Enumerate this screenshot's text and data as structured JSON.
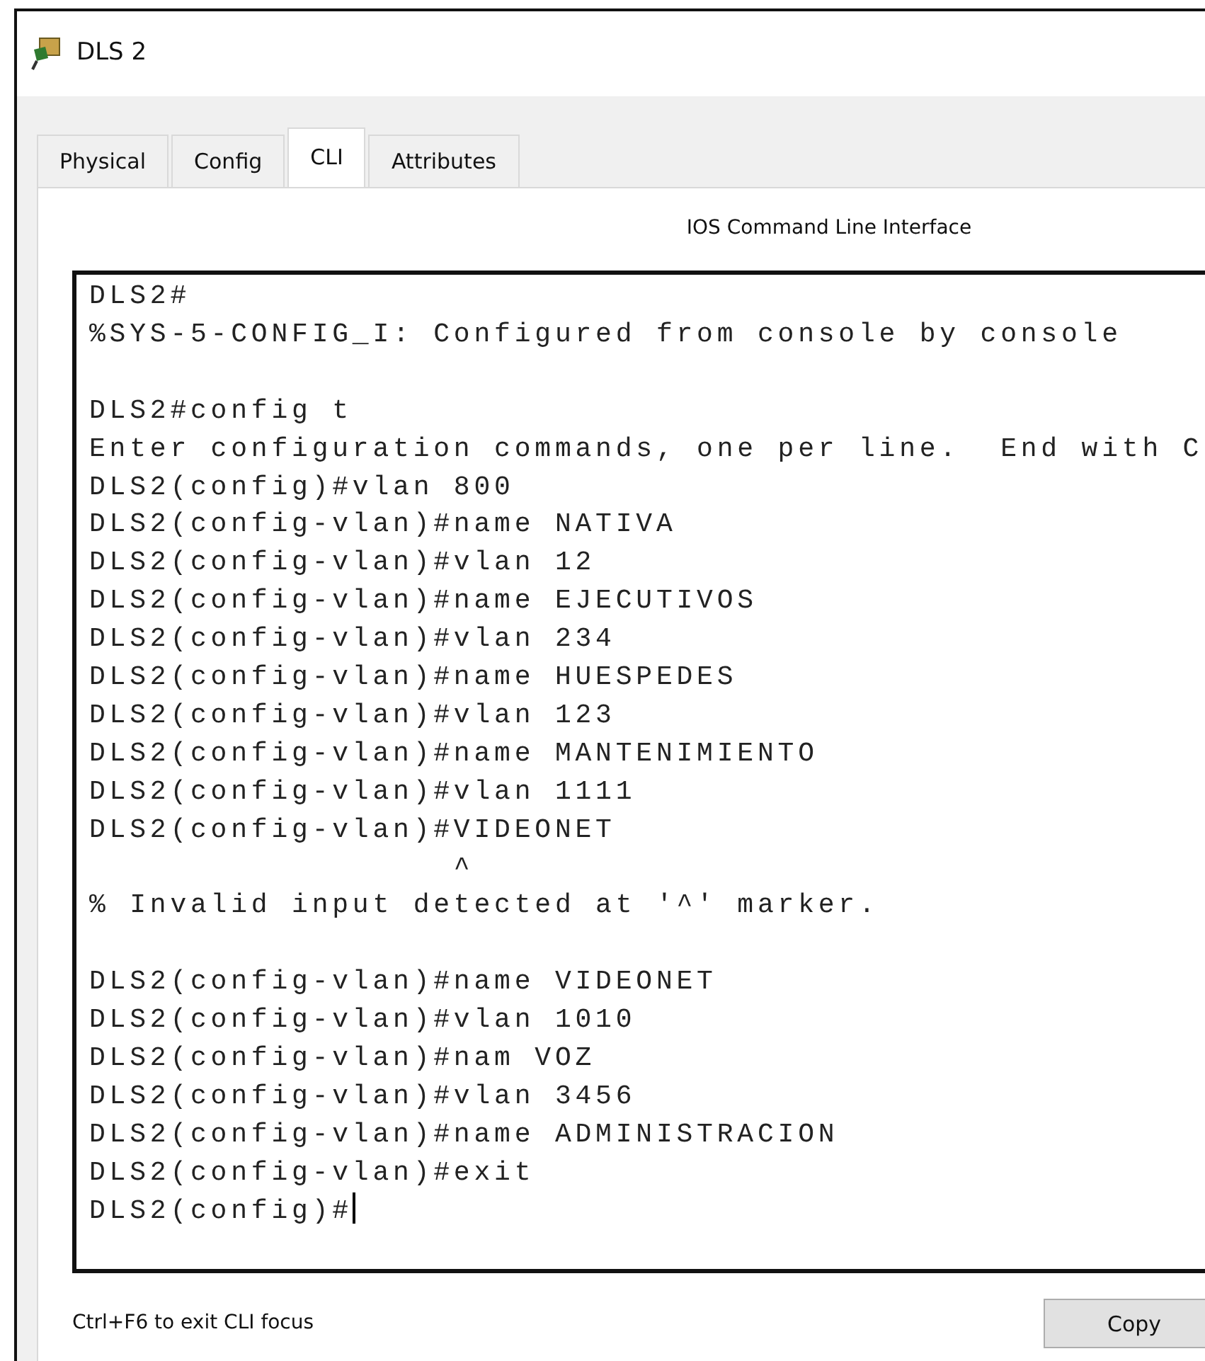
{
  "window": {
    "title": "DLS 2"
  },
  "tabs": [
    {
      "label": "Physical",
      "selected": false
    },
    {
      "label": "Config",
      "selected": false
    },
    {
      "label": "CLI",
      "selected": true
    },
    {
      "label": "Attributes",
      "selected": false
    }
  ],
  "panel_title": "IOS Command Line Interface",
  "console": {
    "cursor": true,
    "lines": [
      {
        "kind": "text",
        "text": "DLS2#"
      },
      {
        "kind": "text",
        "text": "%SYS-5-CONFIG_I: Configured from console by console"
      },
      {
        "kind": "blank"
      },
      {
        "kind": "text",
        "text": "DLS2#config t"
      },
      {
        "kind": "text",
        "text": "Enter configuration commands, one per line.  End with C"
      },
      {
        "kind": "text",
        "text": "DLS2(config)#vlan 800"
      },
      {
        "kind": "text",
        "text": "DLS2(config-vlan)#name NATIVA"
      },
      {
        "kind": "text",
        "text": "DLS2(config-vlan)#vlan 12"
      },
      {
        "kind": "text",
        "text": "DLS2(config-vlan)#name EJECUTIVOS"
      },
      {
        "kind": "text",
        "text": "DLS2(config-vlan)#vlan 234"
      },
      {
        "kind": "text",
        "text": "DLS2(config-vlan)#name HUESPEDES"
      },
      {
        "kind": "text",
        "text": "DLS2(config-vlan)#vlan 123"
      },
      {
        "kind": "text",
        "text": "DLS2(config-vlan)#name MANTENIMIENTO"
      },
      {
        "kind": "text",
        "text": "DLS2(config-vlan)#vlan 1111"
      },
      {
        "kind": "text",
        "text": "DLS2(config-vlan)#VIDEONET"
      },
      {
        "kind": "text",
        "text": "                  ^"
      },
      {
        "kind": "text",
        "text": "% Invalid input detected at '^' marker."
      },
      {
        "kind": "blank"
      },
      {
        "kind": "text",
        "text": "DLS2(config-vlan)#name VIDEONET"
      },
      {
        "kind": "text",
        "text": "DLS2(config-vlan)#vlan 1010"
      },
      {
        "kind": "text",
        "text": "DLS2(config-vlan)#nam VOZ"
      },
      {
        "kind": "text",
        "text": "DLS2(config-vlan)#vlan 3456"
      },
      {
        "kind": "text",
        "text": "DLS2(config-vlan)#name ADMINISTRACION"
      },
      {
        "kind": "text",
        "text": "DLS2(config-vlan)#exit"
      },
      {
        "kind": "text",
        "text": "DLS2(config)#"
      }
    ]
  },
  "footer": {
    "hint": "Ctrl+F6 to exit CLI focus",
    "copy_button": "Copy"
  }
}
